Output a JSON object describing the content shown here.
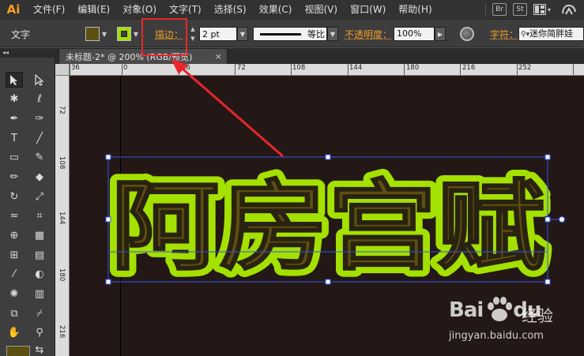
{
  "app": {
    "logo": "Ai",
    "menu": [
      "文件(F)",
      "编辑(E)",
      "对象(O)",
      "文字(T)",
      "选择(S)",
      "效果(C)",
      "视图(V)",
      "窗口(W)",
      "帮助(H)"
    ],
    "badges": [
      "Br",
      "St"
    ]
  },
  "control": {
    "type_label": "文字",
    "fill_color": "#5c5012",
    "stroke_color": "#a4e000",
    "stroke_label": "描边：",
    "stroke_width": "2 pt",
    "profile_label": "等比",
    "opacity_label": "不透明度：",
    "opacity_value": "100%",
    "char_label": "字符：",
    "font_value": "迷你简胖娃"
  },
  "panel": {
    "collapse": "◂◂"
  },
  "document": {
    "tab_title": "未标题-2* @ 200% (RGB/预览)",
    "tab_close": "×"
  },
  "ruler": {
    "h_ticks": [
      "36",
      "0",
      "36",
      "72",
      "108",
      "144",
      "180",
      "216",
      "252"
    ],
    "v_ticks": [
      "72",
      "108",
      "144",
      "180",
      "216"
    ]
  },
  "artwork": {
    "text": "阿房宫赋",
    "fill_color": "#5c5012",
    "stroke_color": "#a4e000",
    "selection_color": "#3355ee",
    "annotation_color": "#e8262b"
  },
  "watermark": {
    "logo_left": "Bai",
    "logo_right": "du",
    "site": "经验",
    "url": "jingyan.baidu.com"
  }
}
